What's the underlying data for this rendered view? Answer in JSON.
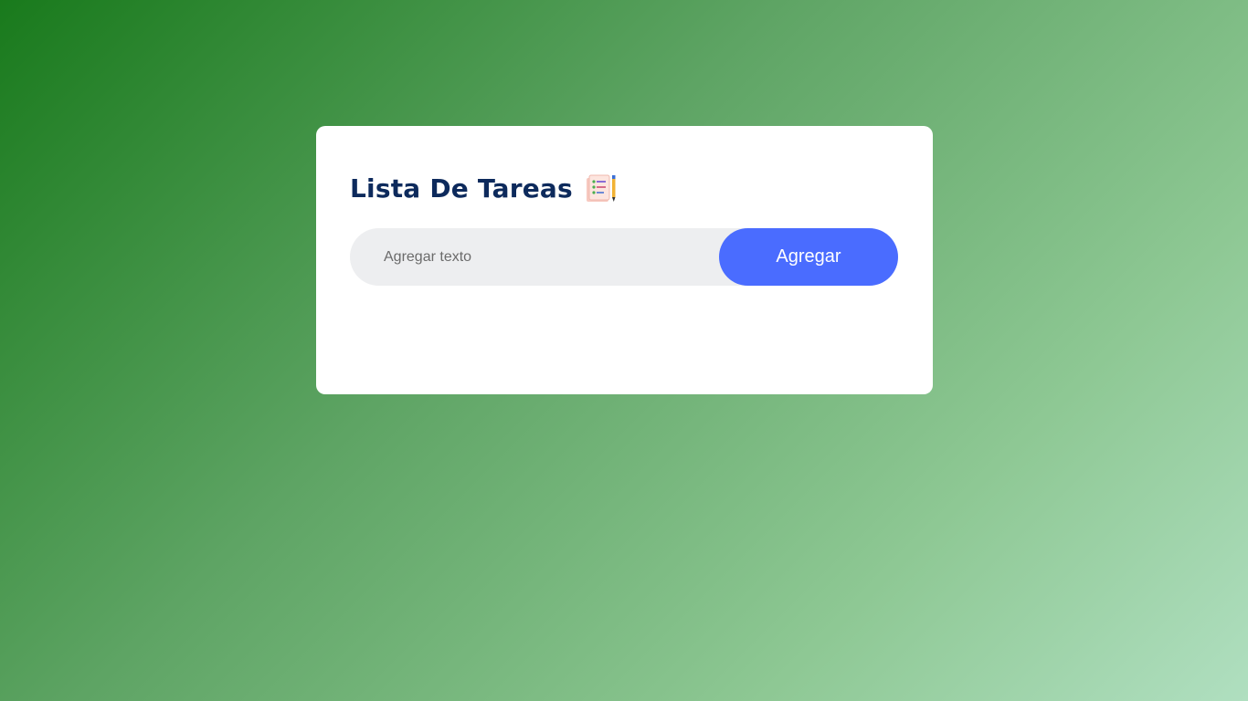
{
  "app": {
    "title": "Lista De Tareas",
    "title_icon": "clipboard-checklist-pencil-icon"
  },
  "form": {
    "input_placeholder": "Agregar texto",
    "input_value": "",
    "add_button_label": "Agregar"
  },
  "tasks": [],
  "colors": {
    "title": "#0d2a5c",
    "button": "#4a6cff",
    "input_bg": "#edeef0",
    "background_start": "#197a1c",
    "background_end": "#b0dfc0"
  }
}
